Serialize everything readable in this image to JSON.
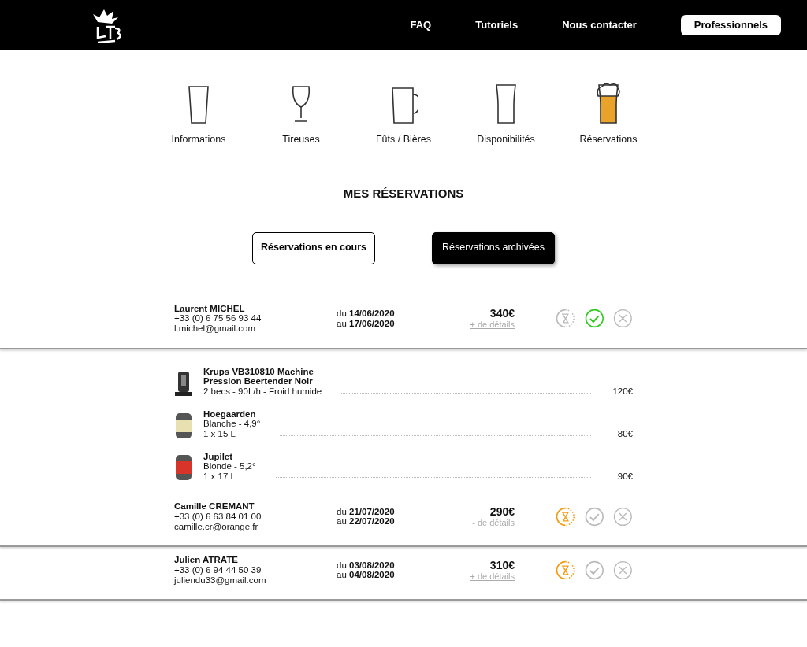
{
  "navbar": {
    "links": [
      "FAQ",
      "Tutoriels",
      "Nous contacter"
    ],
    "button": "Professionnels"
  },
  "steps": [
    {
      "label": "Informations",
      "kind": "tumbler",
      "active": false
    },
    {
      "label": "Tireuses",
      "kind": "tulip",
      "active": false
    },
    {
      "label": "Fûts / Bières",
      "kind": "mug",
      "active": false
    },
    {
      "label": "Disponibilités",
      "kind": "pint",
      "active": false
    },
    {
      "label": "Réservations",
      "kind": "pint",
      "active": true
    }
  ],
  "title": "MES RÉSERVATIONS",
  "tabs": [
    {
      "label": "Réservations en cours",
      "selected": false
    },
    {
      "label": "Réservations archivées",
      "selected": true
    }
  ],
  "reservations": [
    {
      "name": "Laurent MICHEL",
      "phone": "+33 (0) 6 75 56 93 44",
      "email": "l.michel@gmail.com",
      "from_prefix": "du",
      "from": "14/06/2020",
      "to_prefix": "au",
      "to": "17/06/2020",
      "price": "340€",
      "details": "+ de détails",
      "confirmed": true
    },
    {
      "name": "Camille CREMANT",
      "phone": "+33 (0) 6 63 84 01 00",
      "email": "camille.cr@orange.fr",
      "from_prefix": "du",
      "from": "21/07/2020",
      "to_prefix": "au",
      "to": "22/07/2020",
      "price": "290€",
      "details": "- de détails",
      "confirmed": false,
      "items": [
        {
          "kind": "machine",
          "title": "Krups VB310810 Machine Pression Beertender Noir",
          "lines": [
            "2 becs - 90L/h - Froid humide"
          ],
          "price": "120€"
        },
        {
          "kind": "keg",
          "color": "#e8e0b0",
          "title": "Hoegaarden",
          "lines": [
            "Blanche - 4,9°",
            "1 x 15 L"
          ],
          "price": "80€"
        },
        {
          "kind": "keg",
          "color": "#d8342a",
          "title": "Jupilet",
          "lines": [
            "Blonde - 5,2°",
            "1 x 17 L"
          ],
          "price": "90€"
        }
      ]
    },
    {
      "name": "Julien ATRATE",
      "phone": "+33 (0) 6 94 44 50 39",
      "email": "juliendu33@gmail.com",
      "from_prefix": "du",
      "from": "03/08/2020",
      "to_prefix": "au",
      "to": "04/08/2020",
      "price": "310€",
      "details": "+ de détails",
      "confirmed": false
    }
  ]
}
